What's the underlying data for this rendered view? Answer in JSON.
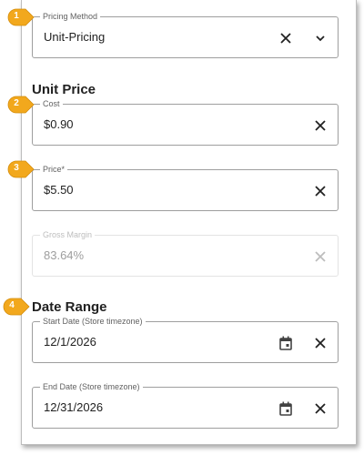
{
  "callouts": [
    "1",
    "2",
    "3",
    "4"
  ],
  "colors": {
    "callout_fill": "#f2a81d",
    "border": "#9e9e9e",
    "disabled_border": "#e3e3e3",
    "text": "#212121",
    "muted_text": "#9e9e9e"
  },
  "pricing_method": {
    "label": "Pricing Method",
    "value": "Unit-Pricing",
    "clear_icon": "close-icon",
    "dropdown_icon": "chevron-down-icon"
  },
  "unit_price": {
    "heading": "Unit Price",
    "cost": {
      "label": "Cost",
      "value": "$0.90",
      "clear_icon": "close-icon"
    },
    "price": {
      "label": "Price*",
      "value": "$5.50",
      "clear_icon": "close-icon"
    },
    "gross_margin": {
      "label": "Gross Margin",
      "value": "83.64%",
      "clear_icon": "close-icon"
    }
  },
  "date_range": {
    "heading": "Date Range",
    "start_date": {
      "label": "Start Date (Store timezone)",
      "value": "12/1/2026",
      "calendar_icon": "calendar-icon",
      "clear_icon": "close-icon"
    },
    "end_date": {
      "label": "End Date (Store timezone)",
      "value": "12/31/2026",
      "calendar_icon": "calendar-icon",
      "clear_icon": "close-icon"
    }
  }
}
